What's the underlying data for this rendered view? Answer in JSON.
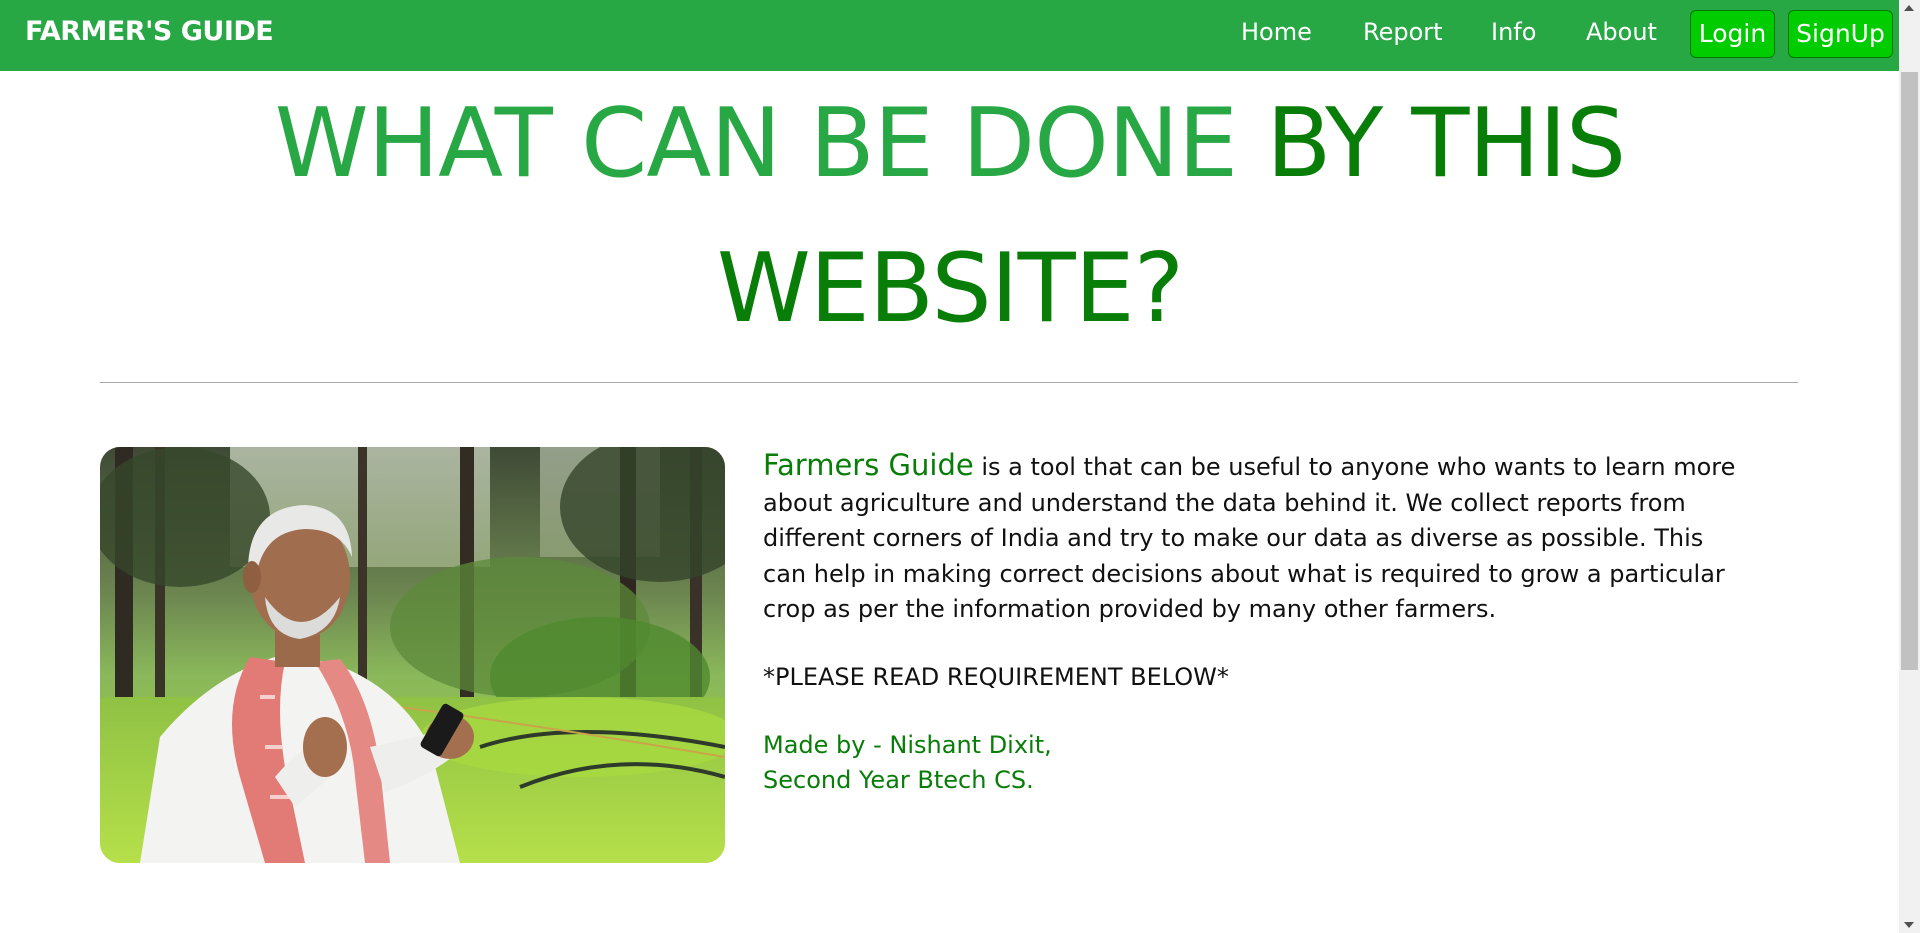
{
  "navbar": {
    "brand": "FARMER'S GUIDE",
    "links": {
      "home": "Home",
      "report": "Report",
      "info": "Info",
      "about": "About"
    },
    "login_label": "Login",
    "signup_label": "SignUp"
  },
  "hero": {
    "title_part1": "WHAT CAN BE DONE",
    "title_part2": "BY THIS",
    "title_part3": "WEBSITE?"
  },
  "about": {
    "brand_name": "Farmers Guide",
    "description": " is a tool that can be useful to anyone who wants to learn more about agriculture and understand the data behind it. We collect reports from different corners of India and try to make our data as diverse as possible. This can help in making correct decisions about what is required to grow a particular crop as per the information provided by many other farmers.",
    "note": "*PLEASE READ REQUIREMENT BELOW*",
    "credit_line1": "Made by - Nishant Dixit,",
    "credit_line2": "Second Year Btech CS."
  },
  "colors": {
    "navbar_bg": "#28a745",
    "button_bg": "#00cc00",
    "accent_light": "#28a745",
    "accent_dark": "#087d08"
  },
  "image": {
    "alt": "farmer using smartphone in field"
  }
}
